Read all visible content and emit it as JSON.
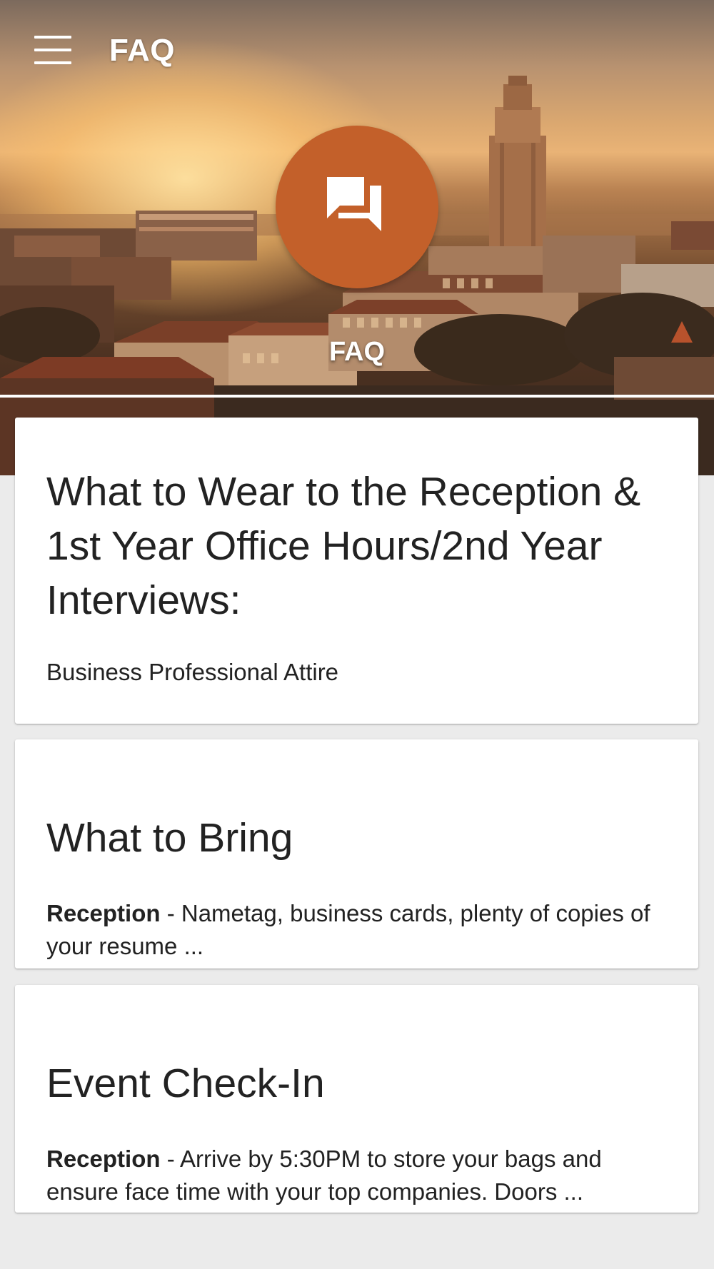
{
  "app_bar": {
    "title": "FAQ",
    "menu_icon": "hamburger-menu-icon"
  },
  "hero": {
    "label": "FAQ",
    "fab_icon": "chat-bubbles-icon",
    "accent": "#c3602a"
  },
  "faq_items": [
    {
      "title": "What to Wear to the Reception & 1st Year Office Hours/2nd Year Interviews:",
      "body_lead": "",
      "body_text": "Business Professional Attire"
    },
    {
      "title": "What to Bring",
      "body_lead": "Reception",
      "body_text": " - Nametag, business cards, plenty of copies of your resume ..."
    },
    {
      "title": "Event Check-In",
      "body_lead": "Reception",
      "body_text": " - Arrive by 5:30PM to store your bags and ensure face time with your top companies. Doors ..."
    }
  ]
}
